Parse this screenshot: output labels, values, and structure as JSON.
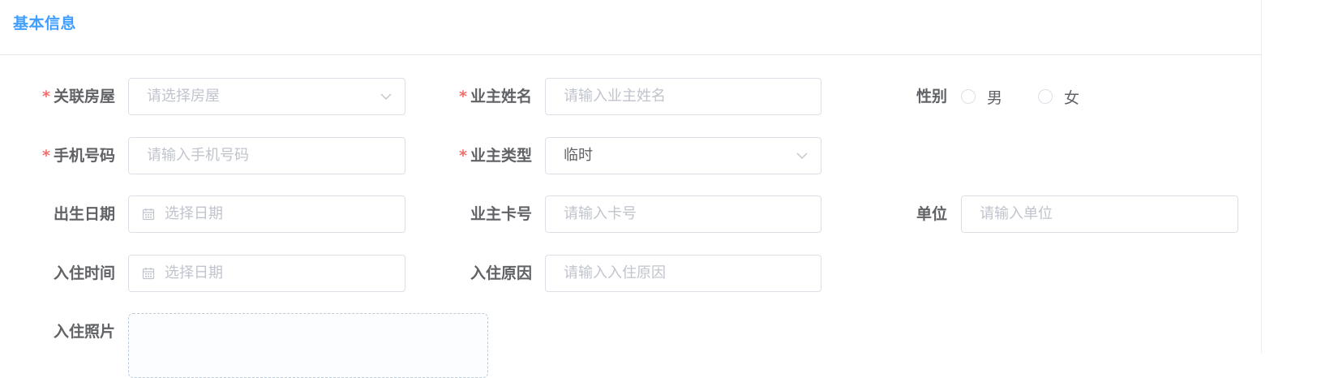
{
  "card": {
    "title": "基本信息"
  },
  "form": {
    "house": {
      "label": "关联房屋",
      "placeholder": "请选择房屋",
      "required": true
    },
    "owner_name": {
      "label": "业主姓名",
      "placeholder": "请输入业主姓名",
      "required": true
    },
    "gender": {
      "label": "性别",
      "options": [
        "男",
        "女"
      ]
    },
    "phone": {
      "label": "手机号码",
      "placeholder": "请输入手机号码",
      "required": true
    },
    "owner_type": {
      "label": "业主类型",
      "value": "临时",
      "required": true
    },
    "birthday": {
      "label": "出生日期",
      "placeholder": "选择日期"
    },
    "card_no": {
      "label": "业主卡号",
      "placeholder": "请输入卡号"
    },
    "company": {
      "label": "单位",
      "placeholder": "请输入单位"
    },
    "checkin_time": {
      "label": "入住时间",
      "placeholder": "选择日期"
    },
    "checkin_reason": {
      "label": "入住原因",
      "placeholder": "请输入入住原因"
    },
    "checkin_photo": {
      "label": "入住照片"
    }
  },
  "required_mark": "*",
  "colors": {
    "accent": "#409eff",
    "required": "#f56c6c",
    "label": "#606266",
    "placeholder": "#c0c4cc",
    "border": "#dcdfe6"
  },
  "icons": {
    "select_arrow": "chevron-down-icon",
    "date_picker": "calendar-icon"
  }
}
